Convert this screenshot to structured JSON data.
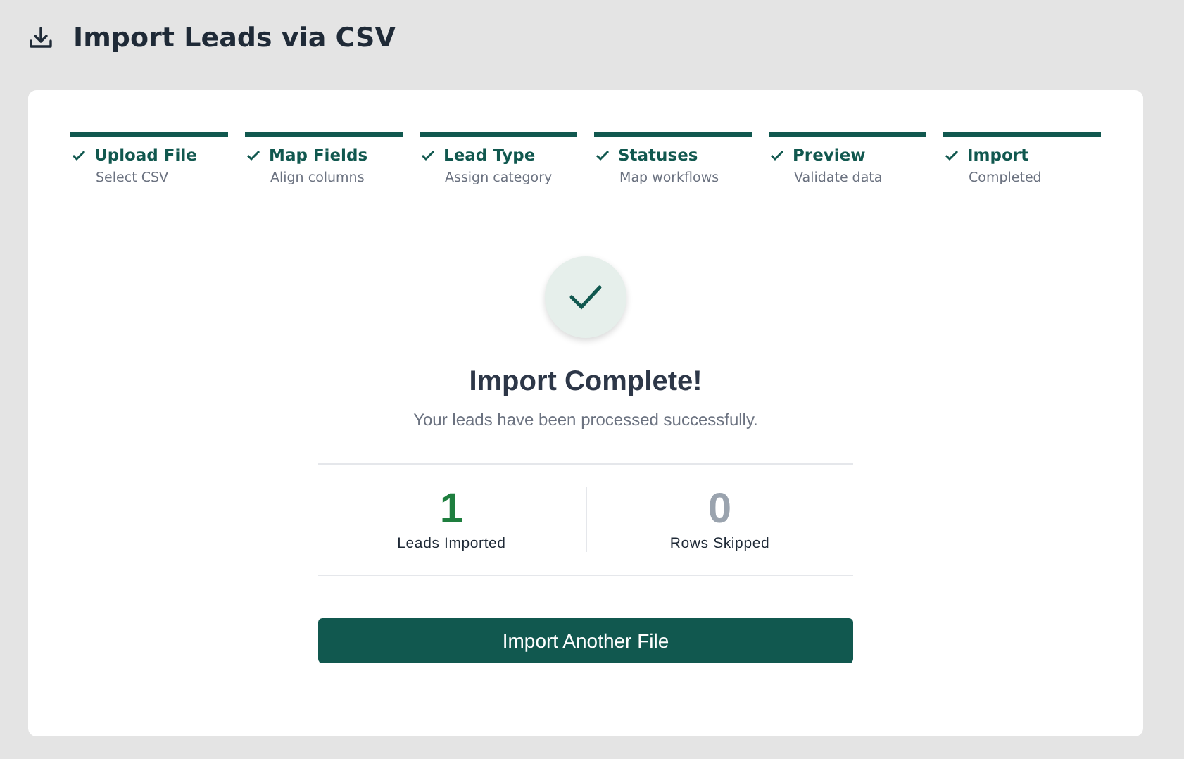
{
  "header": {
    "title": "Import Leads via CSV"
  },
  "steps": [
    {
      "title": "Upload File",
      "subtitle": "Select CSV",
      "completed": true
    },
    {
      "title": "Map Fields",
      "subtitle": "Align columns",
      "completed": true
    },
    {
      "title": "Lead Type",
      "subtitle": "Assign category",
      "completed": true
    },
    {
      "title": "Statuses",
      "subtitle": "Map workflows",
      "completed": true
    },
    {
      "title": "Preview",
      "subtitle": "Validate data",
      "completed": true
    },
    {
      "title": "Import",
      "subtitle": "Completed",
      "completed": true
    }
  ],
  "result": {
    "title": "Import Complete!",
    "message": "Your leads have been processed successfully."
  },
  "stats": [
    {
      "value": "1",
      "label": "Leads Imported",
      "color": "#1e7e3e"
    },
    {
      "value": "0",
      "label": "Rows Skipped",
      "color": "#9aa3ae"
    }
  ],
  "button": {
    "label": "Import Another File"
  }
}
